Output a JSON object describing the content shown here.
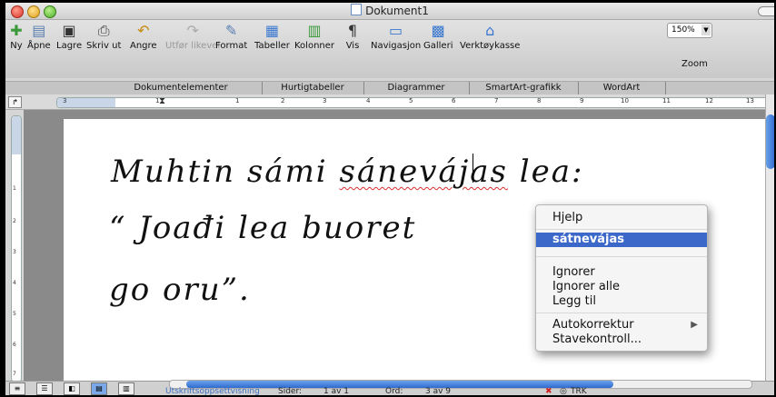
{
  "window": {
    "title": "Dokument1"
  },
  "toolbar": {
    "items": [
      {
        "label": "Ny",
        "icon": "new-doc-icon",
        "glyph": "✚"
      },
      {
        "label": "Åpne",
        "icon": "open-folder-icon",
        "glyph": "▤"
      },
      {
        "label": "Lagre",
        "icon": "save-disk-icon",
        "glyph": "▣"
      },
      {
        "label": "Skriv ut",
        "icon": "printer-icon",
        "glyph": "⎙"
      },
      {
        "label": "Angre",
        "icon": "undo-icon",
        "glyph": "↶"
      },
      {
        "label": "Utfør likevel",
        "icon": "redo-icon",
        "glyph": "↷"
      },
      {
        "label": "Format",
        "icon": "format-brush-icon",
        "glyph": "✎"
      },
      {
        "label": "Tabeller",
        "icon": "table-grid-icon",
        "glyph": "▦"
      },
      {
        "label": "Kolonner",
        "icon": "columns-icon",
        "glyph": "▥"
      },
      {
        "label": "Vis",
        "icon": "pilcrow-icon",
        "glyph": "¶"
      },
      {
        "label": "Navigasjon",
        "icon": "navigation-pane-icon",
        "glyph": "▭"
      },
      {
        "label": "Galleri",
        "icon": "gallery-icon",
        "glyph": "▩"
      },
      {
        "label": "Verktøykasse",
        "icon": "toolbox-icon",
        "glyph": "⌂"
      },
      {
        "label": "Zoom",
        "icon": "zoom-icon",
        "glyph": ""
      }
    ],
    "zoom_value": "150%"
  },
  "ribbon_tabs": [
    "Dokumentelementer",
    "Hurtigtabeller",
    "Diagrammer",
    "SmartArt-grafikk",
    "WordArt"
  ],
  "ruler": {
    "ticks": [
      "3",
      "1",
      "1",
      "2",
      "3",
      "4",
      "5",
      "6",
      "7",
      "8",
      "9",
      "10",
      "11",
      "12",
      "13"
    ]
  },
  "vruler": {
    "ticks": [
      "1",
      "2",
      "3",
      "4",
      "5",
      "6",
      "7"
    ]
  },
  "document": {
    "line1_a": "Muhtin sámi ",
    "line1_misspelled": "sánevájas",
    "line1_b": " lea:",
    "line2": "“ Joađi lea buoret",
    "line3": "go oru”."
  },
  "context_menu": {
    "help": "Hjelp",
    "suggestion": "sátnevájas",
    "ignore": "Ignorer",
    "ignore_all": "Ignorer alle",
    "add": "Legg til",
    "autocorrect": "Autokorrektur",
    "spelling": "Stavekontroll...",
    "arrow": "▶"
  },
  "status": {
    "view_name": "Utskriftsoppsettvisning",
    "pages_label": "Sider:",
    "pages_value": "1 av 1",
    "words_label": "Ord:",
    "words_value": "3 av 9",
    "trk": "TRK"
  },
  "colors": {
    "selection": "#3b68c9",
    "misspelling": "#d83030",
    "scroll_thumb": "#2f6ad0"
  }
}
